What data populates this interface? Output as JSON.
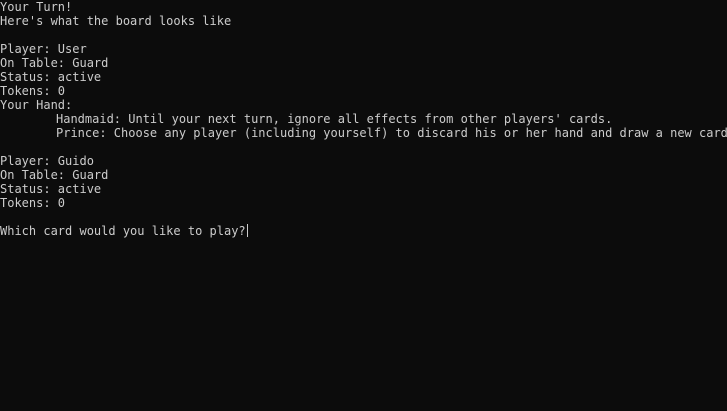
{
  "header": {
    "turn": "Your Turn!",
    "board_intro": "Here's what the board looks like"
  },
  "players": [
    {
      "player": "Player: User",
      "on_table": "On Table: Guard",
      "status": "Status: active",
      "tokens": "Tokens: 0",
      "hand_label": "Your Hand:",
      "hand": [
        "Handmaid: Until your next turn, ignore all effects from other players' cards.",
        "Prince: Choose any player (including yourself) to discard his or her hand and draw a new card."
      ]
    },
    {
      "player": "Player: Guido",
      "on_table": "On Table: Guard",
      "status": "Status: active",
      "tokens": "Tokens: 0"
    }
  ],
  "prompt": {
    "text": "Which card would you like to play?",
    "input_value": ""
  },
  "colors": {
    "background": "#0c0c0c",
    "text": "#cccccc"
  }
}
